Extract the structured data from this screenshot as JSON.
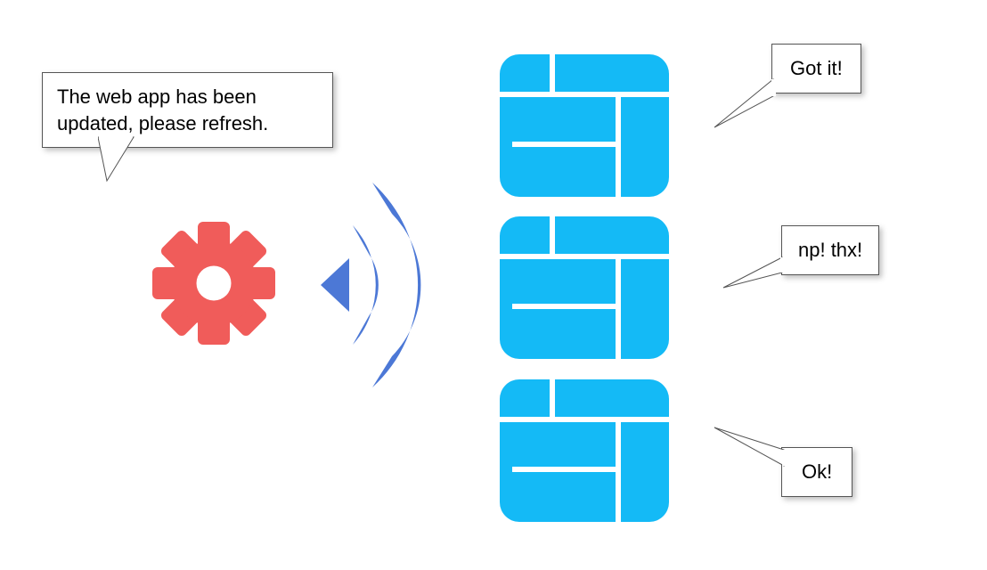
{
  "gear_speech": "The web app has been updated, please refresh.",
  "windows": [
    {
      "reply": "Got it!"
    },
    {
      "reply": "np! thx!"
    },
    {
      "reply": "Ok!"
    }
  ],
  "colors": {
    "gear": "#f05c5a",
    "signal": "#4c78d6",
    "window": "#14baf6"
  }
}
